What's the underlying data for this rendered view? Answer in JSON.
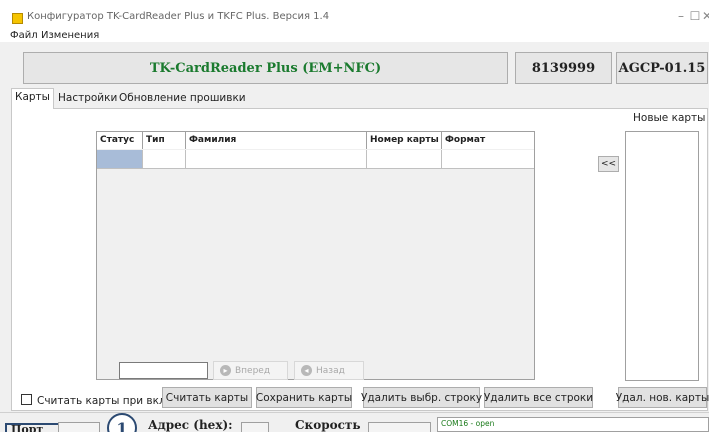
{
  "window": {
    "title": "Конфигуратор  TK-CardReader Plus  и  TKFC Plus.  Версия 1.4",
    "controls": {
      "minimize": "–",
      "maximize": "☐",
      "close": "✕"
    }
  },
  "menu": {
    "items": [
      "Файл",
      "Изменения"
    ]
  },
  "header": {
    "device_name": "TK-CardReader Plus (EM+NFC)",
    "device_name_color": "#1a7a2e",
    "serial": "8139999",
    "firmware": "AGCP-01.15"
  },
  "tabs": [
    "Карты",
    "Настройки",
    "Обновление прошивки"
  ],
  "active_tab": "Карты",
  "table": {
    "columns": [
      "Статус",
      "Тип",
      "Фамилия",
      "Номер карты",
      "Формат"
    ]
  },
  "navigation": {
    "forward": "Вперед",
    "back": "Назад"
  },
  "new_cards": {
    "label": "Новые карты",
    "move_button": "<<"
  },
  "options": {
    "read_on_start_label": "Считать карты при вкл.",
    "read_on_start_checked": false
  },
  "buttons": {
    "read_cards": "Считать карты",
    "save_cards": "Сохранить карты",
    "delete_selected": "Удалить выбр. строку",
    "delete_all": "Удалить все строки",
    "delete_new": "Удал. нов. карты"
  },
  "status": {
    "left_label": "Порт",
    "address_label": "Адрес (hex):",
    "address_value": "",
    "speed_label": "Скорость",
    "callout_number": "1",
    "com_log": "COM16 - open"
  }
}
